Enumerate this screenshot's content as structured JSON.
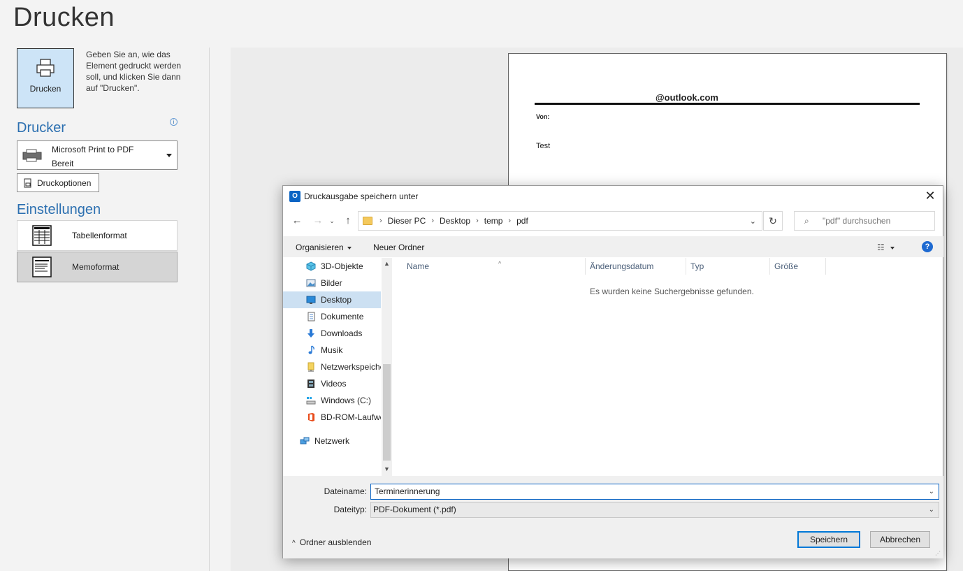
{
  "page": {
    "title": "Drucken",
    "print_button_label": "Drucken",
    "print_description": "Geben Sie an, wie das Element gedruckt werden soll, und klicken Sie dann auf \"Drucken\".",
    "printer_section": "Drucker",
    "printer_name": "Microsoft Print to PDF",
    "printer_status": "Bereit",
    "print_options_label": "Druckoptionen",
    "settings_section": "Einstellungen",
    "formats": [
      {
        "label": "Tabellenformat",
        "selected": false
      },
      {
        "label": "Memoformat",
        "selected": true
      }
    ]
  },
  "preview": {
    "header": "@outlook.com",
    "from_label": "Von:",
    "body_text": "Test"
  },
  "dialog": {
    "title": "Druckausgabe speichern unter",
    "breadcrumbs": [
      "Dieser PC",
      "Desktop",
      "temp",
      "pdf"
    ],
    "search_placeholder": "\"pdf\" durchsuchen",
    "organize_label": "Organisieren",
    "new_folder_label": "Neuer Ordner",
    "tree": [
      {
        "label": "3D-Objekte",
        "icon": "cube-icon",
        "selected": false
      },
      {
        "label": "Bilder",
        "icon": "picture-icon",
        "selected": false
      },
      {
        "label": "Desktop",
        "icon": "desktop-icon",
        "selected": true
      },
      {
        "label": "Dokumente",
        "icon": "document-icon",
        "selected": false
      },
      {
        "label": "Downloads",
        "icon": "download-arrow-icon",
        "selected": false
      },
      {
        "label": "Musik",
        "icon": "music-note-icon",
        "selected": false
      },
      {
        "label": "Netzwerkspeiche",
        "icon": "network-share-icon",
        "selected": false
      },
      {
        "label": "Videos",
        "icon": "film-icon",
        "selected": false
      },
      {
        "label": "Windows (C:)",
        "icon": "drive-icon",
        "selected": false
      },
      {
        "label": "BD-ROM-Laufwe",
        "icon": "office-icon",
        "selected": false
      },
      {
        "label": "Netzwerk",
        "icon": "network-icon",
        "selected": false
      }
    ],
    "columns": [
      "Name",
      "Änderungsdatum",
      "Typ",
      "Größe"
    ],
    "empty_message": "Es wurden keine Suchergebnisse gefunden.",
    "filename_label": "Dateiname:",
    "filename_value": "Terminerinnerung",
    "filetype_label": "Dateityp:",
    "filetype_value": "PDF-Dokument (*.pdf)",
    "hide_folders_label": "Ordner ausblenden",
    "save_label": "Speichern",
    "cancel_label": "Abbrechen"
  },
  "colors": {
    "accent": "#2b6fb0",
    "selection": "#cde4f7",
    "primary_border": "#0078d7"
  }
}
